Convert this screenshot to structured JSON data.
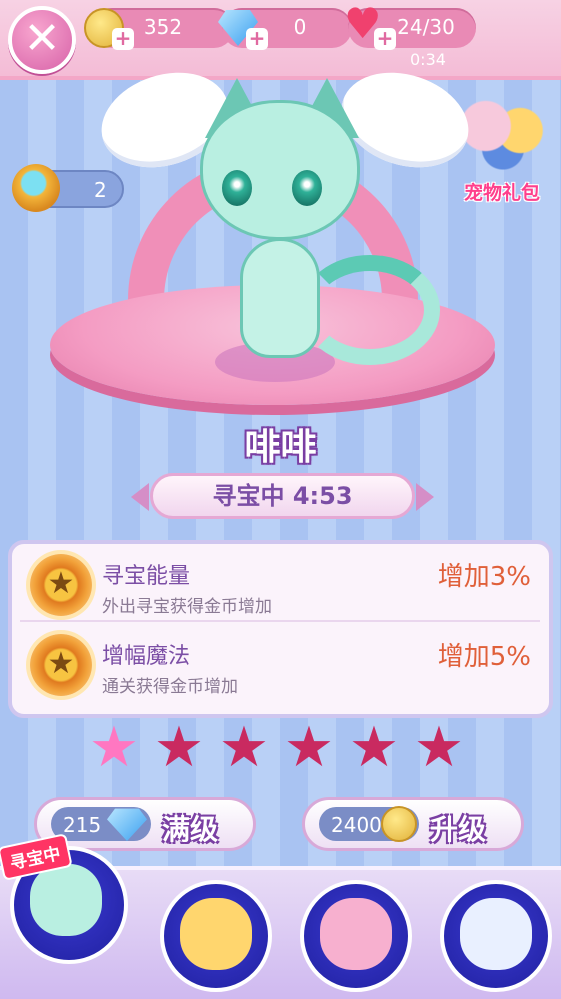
{
  "top_bar": {
    "coins": "352",
    "gems": "0",
    "hearts": "24/30",
    "timer": "0:34",
    "close_glyph": "✕",
    "plus_glyph": "+",
    "heart_glyph": "♥"
  },
  "keys": {
    "count": "2"
  },
  "gift_pack": {
    "label": "宠物礼包"
  },
  "pet": {
    "name": "啡啡",
    "status": "寻宝中 4:53"
  },
  "skills": [
    {
      "title": "寻宝能量",
      "desc": "外出寻宝获得金币增加",
      "value": "增加3%"
    },
    {
      "title": "增幅魔法",
      "desc": "通关获得金币增加",
      "value": "增加5%"
    }
  ],
  "skill_icon_glyph": "★",
  "stars": {
    "filled": 1,
    "total": 6,
    "glyph": "★"
  },
  "actions": {
    "max_level": {
      "cost": "215",
      "label": "满级"
    },
    "upgrade": {
      "cost": "2400",
      "label": "升级"
    }
  },
  "bottom": {
    "active_tag": "寻宝中"
  },
  "colors": {
    "pink": "#f49cc3",
    "purple": "#7b4ea5",
    "orange": "#e0603a",
    "star_on": "#ff77c1",
    "star_off": "#c92a60"
  }
}
